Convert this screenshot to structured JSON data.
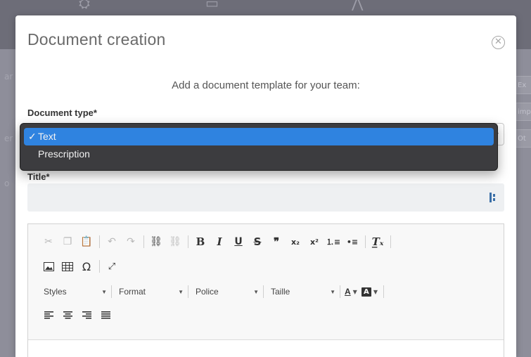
{
  "modal": {
    "title": "Document creation",
    "close_icon": "close-circle-icon",
    "subtitle": "Add a document template for your team:"
  },
  "form": {
    "document_type_label": "Document type*",
    "title_label": "Title*",
    "title_value": "",
    "title_input_icon": "password-manager-icon"
  },
  "dropdown": {
    "options": [
      {
        "label": "Text",
        "selected": true
      },
      {
        "label": "Prescription",
        "selected": false
      }
    ],
    "check_mark": "✓"
  },
  "editor": {
    "toolbar_row1": [
      "cut-icon",
      "copy-icon",
      "paste-icon",
      "undo-icon",
      "redo-icon",
      "link-icon",
      "unlink-icon",
      "bold-icon",
      "italic-icon",
      "underline-icon",
      "strike-icon",
      "quote-icon",
      "subscript-icon",
      "superscript-icon",
      "numbered-list-icon",
      "bulleted-list-icon",
      "remove-format-icon"
    ],
    "toolbar_row2": [
      "image-icon",
      "table-icon",
      "special-char-icon",
      "maximize-icon"
    ],
    "combos": {
      "styles": "Styles",
      "format": "Format",
      "police": "Police",
      "taille": "Taille"
    },
    "text_color_label": "A",
    "bg_color_label": "A",
    "toolbar_row4": [
      "align-left-icon",
      "align-center-icon",
      "align-right-icon",
      "justify-icon"
    ]
  },
  "background": {
    "field_hints": [
      "Ex",
      "imp",
      "Ot"
    ],
    "side_letters": [
      "ar",
      "er",
      "o"
    ]
  },
  "colors": {
    "accent": "#2f83e0",
    "dropdown_bg": "#3c3c3f",
    "input_bg": "#eef0f2"
  }
}
